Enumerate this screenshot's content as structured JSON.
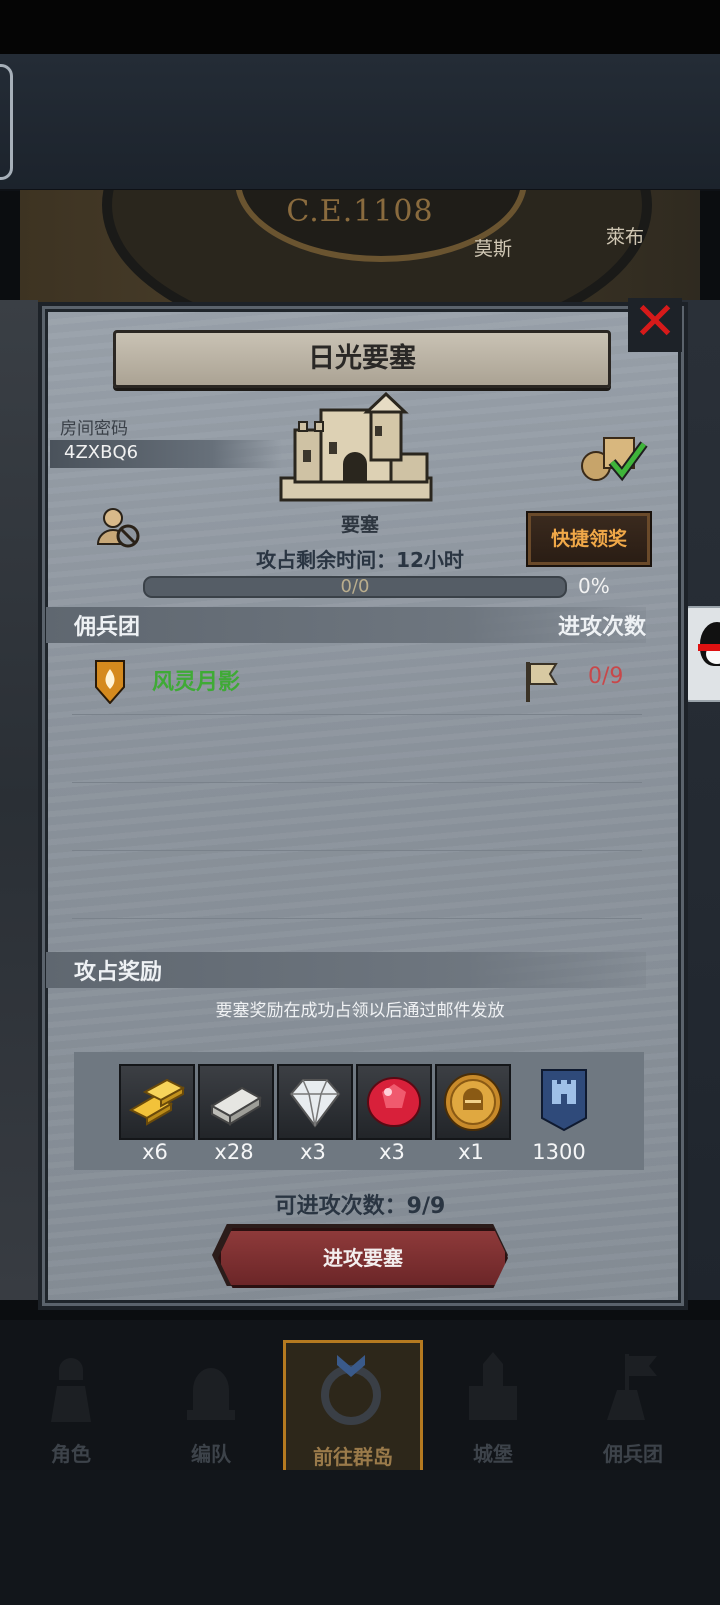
{
  "background": {
    "era": "C.E.1108",
    "map_labels": [
      "莫斯",
      "萊布"
    ]
  },
  "dialog": {
    "title": "日光要塞",
    "close_icon": "close-icon",
    "room_code_label": "房间密码",
    "room_code": "4ZXBQ6",
    "fortress_label": "要塞",
    "occupy_time": "攻占剩余时间：12小时",
    "progress": {
      "text": "0/0",
      "fraction": 0,
      "percent": "0%"
    },
    "quick_claim_label": "快捷领奖",
    "mercenary_section": {
      "title": "佣兵团",
      "attack_count_header": "进攻次数",
      "rows": [
        {
          "name": "风灵月影",
          "attacks": "0/9",
          "name_color": "#3faa36"
        }
      ]
    },
    "reward_section": {
      "title": "攻占奖励",
      "note": "要塞奖励在成功占领以后通过邮件发放",
      "items": [
        {
          "icon": "gold-bars-icon",
          "count": "x6"
        },
        {
          "icon": "iron-ingot-icon",
          "count": "x28"
        },
        {
          "icon": "diamond-icon",
          "count": "x3"
        },
        {
          "icon": "ruby-icon",
          "count": "x3"
        },
        {
          "icon": "knight-coin-icon",
          "count": "x1"
        },
        {
          "icon": "castle-banner-icon",
          "count": "1300"
        }
      ]
    },
    "attack_remaining": "可进攻次数：9/9",
    "attack_button_label": "进攻要塞"
  },
  "nav": {
    "items": [
      {
        "label": "角色",
        "icon": "knight-icon",
        "active": false
      },
      {
        "label": "编队",
        "icon": "helmet-icon",
        "active": false
      },
      {
        "label": "前往群岛",
        "icon": "compass-icon",
        "active": true
      },
      {
        "label": "城堡",
        "icon": "castle-icon",
        "active": false
      },
      {
        "label": "佣兵团",
        "icon": "mercenary-icon",
        "active": false
      }
    ]
  },
  "colors": {
    "panel": "#8f979f",
    "title_plate": "#bdb5a6",
    "close": "#d61a1a",
    "claim_text": "#f0a848",
    "attack_button": "#7a2e30",
    "nav_active": "#b57a20"
  }
}
